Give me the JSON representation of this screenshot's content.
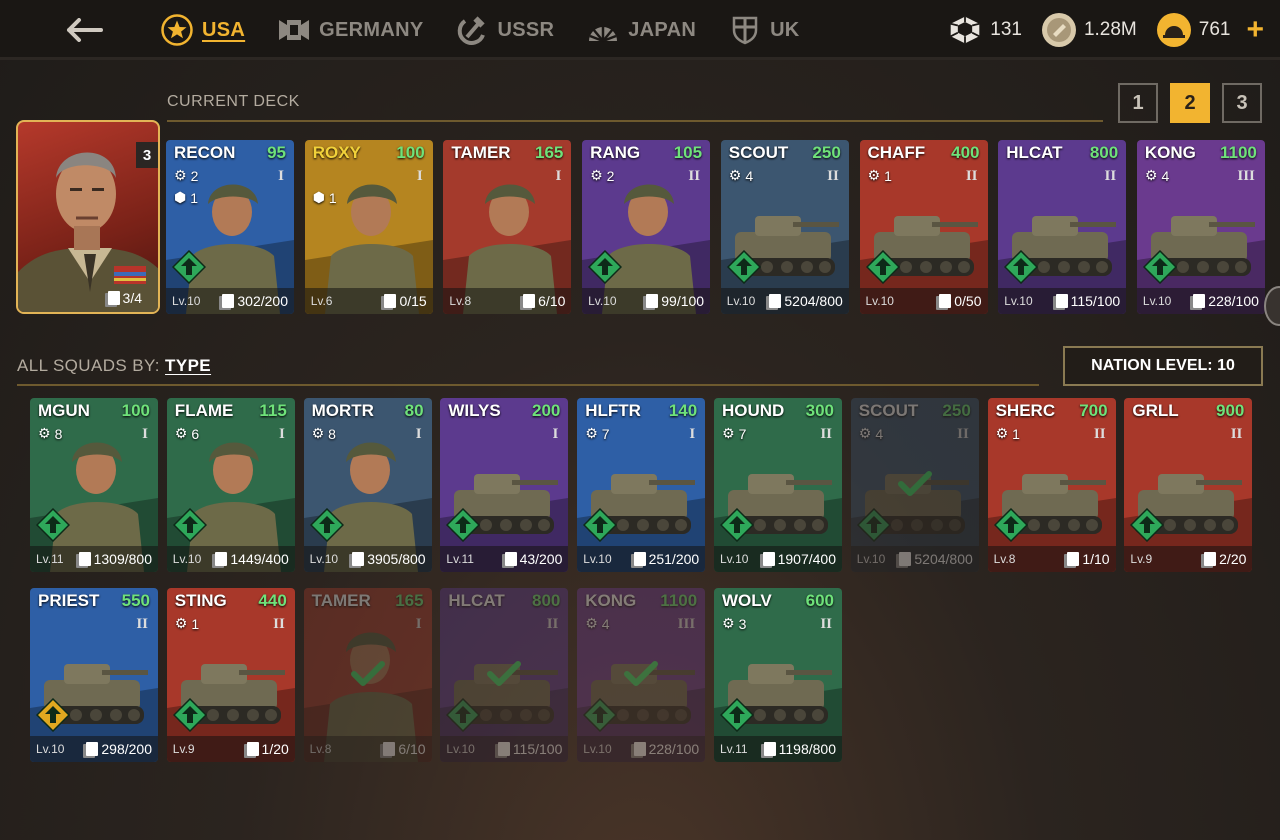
{
  "nations": [
    {
      "label": "USA",
      "icon": "star-icon",
      "active": true
    },
    {
      "label": "GERMANY",
      "icon": "cross-icon",
      "active": false
    },
    {
      "label": "USSR",
      "icon": "hammer-sickle-icon",
      "active": false
    },
    {
      "label": "JAPAN",
      "icon": "rising-sun-icon",
      "active": false
    },
    {
      "label": "UK",
      "icon": "shield-icon",
      "active": false
    }
  ],
  "currency": {
    "parts": "131",
    "silver": "1.28M",
    "gold": "761",
    "plus": "+"
  },
  "deck": {
    "title": "CURRENT DECK",
    "tabs": [
      "1",
      "2",
      "3"
    ],
    "active_tab": "2"
  },
  "commander": {
    "level": "3",
    "cards": "3/4"
  },
  "squads": {
    "title": "ALL SQUADS BY:",
    "filter": "TYPE",
    "nation_level": "NATION LEVEL: 10"
  },
  "deck_cards": [
    {
      "name": "RECON",
      "cost": "95",
      "tier": "I",
      "stat1": "2",
      "stat2": "1",
      "level": "Lv.10",
      "count": "302/200",
      "color": "#2e5fa6",
      "upgrade": true,
      "name_color": "#ffffff"
    },
    {
      "name": "ROXY",
      "cost": "100",
      "tier": "I",
      "stat1": "",
      "stat2": "1",
      "level": "Lv.6",
      "count": "0/15",
      "color": "#b58520",
      "upgrade": false,
      "name_color": "#f2d23a"
    },
    {
      "name": "TAMER",
      "cost": "165",
      "tier": "I",
      "stat1": "",
      "stat2": "",
      "level": "Lv.8",
      "count": "6/10",
      "color": "#a43a2c",
      "upgrade": false,
      "name_color": "#ffffff"
    },
    {
      "name": "RANG",
      "cost": "105",
      "tier": "II",
      "stat1": "2",
      "stat2": "",
      "level": "Lv.10",
      "count": "99/100",
      "color": "#5c3a8e",
      "upgrade": true,
      "name_color": "#ffffff"
    },
    {
      "name": "SCOUT",
      "cost": "250",
      "tier": "II",
      "stat1": "4",
      "stat2": "",
      "level": "Lv.10",
      "count": "5204/800",
      "color": "#3c5670",
      "upgrade": true,
      "name_color": "#ffffff"
    },
    {
      "name": "CHAFF",
      "cost": "400",
      "tier": "II",
      "stat1": "1",
      "stat2": "",
      "level": "Lv.10",
      "count": "0/50",
      "color": "#a8382a",
      "upgrade": true,
      "name_color": "#ffffff"
    },
    {
      "name": "HLCAT",
      "cost": "800",
      "tier": "II",
      "stat1": "",
      "stat2": "",
      "level": "Lv.10",
      "count": "115/100",
      "color": "#5c3a8e",
      "upgrade": true,
      "name_color": "#ffffff"
    },
    {
      "name": "KONG",
      "cost": "1100",
      "tier": "III",
      "stat1": "4",
      "stat2": "",
      "level": "Lv.10",
      "count": "228/100",
      "color": "#6a3a8e",
      "upgrade": true,
      "name_color": "#ffffff"
    }
  ],
  "squad_rows": [
    [
      {
        "name": "MGUN",
        "cost": "100",
        "tier": "I",
        "stat1": "8",
        "level": "Lv.11",
        "count": "1309/800",
        "color": "#2f6b4a",
        "upgrade": true,
        "dim": false
      },
      {
        "name": "FLAME",
        "cost": "115",
        "tier": "I",
        "stat1": "6",
        "level": "Lv.10",
        "count": "1449/400",
        "color": "#2f6b4a",
        "upgrade": true,
        "dim": false
      },
      {
        "name": "MORTR",
        "cost": "80",
        "tier": "I",
        "stat1": "8",
        "level": "Lv.10",
        "count": "3905/800",
        "color": "#3c5670",
        "upgrade": true,
        "dim": false
      },
      {
        "name": "WILYS",
        "cost": "200",
        "tier": "I",
        "stat1": "",
        "level": "Lv.11",
        "count": "43/200",
        "color": "#5c3a8e",
        "upgrade": true,
        "dim": false
      },
      {
        "name": "HLFTR",
        "cost": "140",
        "tier": "I",
        "stat1": "7",
        "level": "Lv.10",
        "count": "251/200",
        "color": "#2e5fa6",
        "upgrade": true,
        "dim": false
      },
      {
        "name": "HOUND",
        "cost": "300",
        "tier": "II",
        "stat1": "7",
        "level": "Lv.10",
        "count": "1907/400",
        "color": "#2f6b4a",
        "upgrade": true,
        "dim": false
      },
      {
        "name": "SCOUT",
        "cost": "250",
        "tier": "II",
        "stat1": "4",
        "level": "Lv.10",
        "count": "5204/800",
        "color": "#3c5670",
        "upgrade": true,
        "dim": true
      },
      {
        "name": "SHERC",
        "cost": "700",
        "tier": "II",
        "stat1": "1",
        "level": "Lv.8",
        "count": "1/10",
        "color": "#a8382a",
        "upgrade": true,
        "dim": false
      },
      {
        "name": "GRLL",
        "cost": "900",
        "tier": "II",
        "stat1": "",
        "level": "Lv.9",
        "count": "2/20",
        "color": "#a8382a",
        "upgrade": true,
        "dim": false
      }
    ],
    [
      {
        "name": "PRIEST",
        "cost": "550",
        "tier": "II",
        "stat1": "",
        "level": "Lv.10",
        "count": "298/200",
        "color": "#2e5fa6",
        "upgrade": false,
        "dim": false
      },
      {
        "name": "STING",
        "cost": "440",
        "tier": "II",
        "stat1": "1",
        "level": "Lv.9",
        "count": "1/20",
        "color": "#a8382a",
        "upgrade": true,
        "dim": false
      },
      {
        "name": "TAMER",
        "cost": "165",
        "tier": "I",
        "stat1": "",
        "level": "Lv.8",
        "count": "6/10",
        "color": "#a43a2c",
        "upgrade": false,
        "dim": true
      },
      {
        "name": "HLCAT",
        "cost": "800",
        "tier": "II",
        "stat1": "",
        "level": "Lv.10",
        "count": "115/100",
        "color": "#5c3a8e",
        "upgrade": true,
        "dim": true
      },
      {
        "name": "KONG",
        "cost": "1100",
        "tier": "III",
        "stat1": "4",
        "level": "Lv.10",
        "count": "228/100",
        "color": "#6a3a8e",
        "upgrade": true,
        "dim": true
      },
      {
        "name": "WOLV",
        "cost": "600",
        "tier": "II",
        "stat1": "3",
        "level": "Lv.11",
        "count": "1198/800",
        "color": "#2f6b4a",
        "upgrade": true,
        "dim": false
      }
    ]
  ]
}
